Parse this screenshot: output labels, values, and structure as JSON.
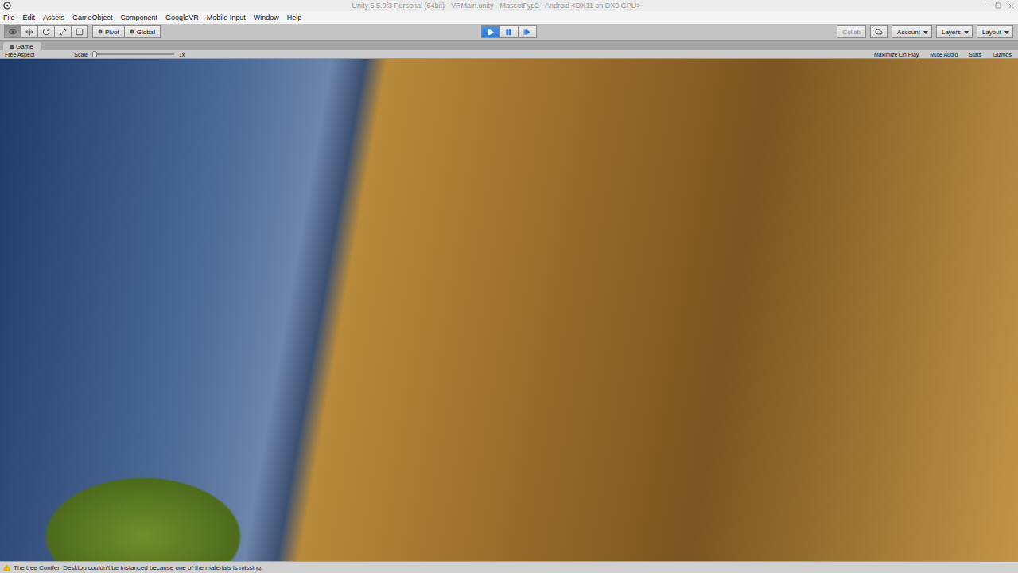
{
  "window": {
    "title": "Unity 5.5.0f3 Personal (64bit) - VRMain.unity - MascotFyp2 - Android <DX11 on DX9 GPU>"
  },
  "menu": [
    "File",
    "Edit",
    "Assets",
    "GameObject",
    "Component",
    "GoogleVR",
    "Mobile Input",
    "Window",
    "Help"
  ],
  "tools": [
    {
      "kind": "view",
      "selected": true
    },
    {
      "kind": "move",
      "selected": false
    },
    {
      "kind": "rotate",
      "selected": false
    },
    {
      "kind": "scale",
      "selected": false
    },
    {
      "kind": "rect",
      "selected": false
    }
  ],
  "handle_buttons": [
    "Pivot",
    "Global"
  ],
  "playback": [
    {
      "kind": "play",
      "selected": true
    },
    {
      "kind": "pause",
      "selected": false
    },
    {
      "kind": "step",
      "selected": false
    }
  ],
  "collab": {
    "label": "Collab",
    "disabled": true
  },
  "dropdowns": [
    "Account",
    "Layers",
    "Layout"
  ],
  "game_panel": {
    "tab": "Game",
    "aspect": "Free Aspect",
    "scale_label": "Scale",
    "scale_level": 0.0,
    "scale_reading": "1x",
    "toggles": [
      {
        "label": "Maximize On Play",
        "on": false
      },
      {
        "label": "Mute Audio",
        "on": false
      },
      {
        "label": "Stats",
        "on": false
      },
      {
        "label": "Gizmos",
        "on": false
      }
    ]
  },
  "status_bar": {
    "message": "The tree Conifer_Desktop couldn't be instanced because one of the materials is missing."
  }
}
